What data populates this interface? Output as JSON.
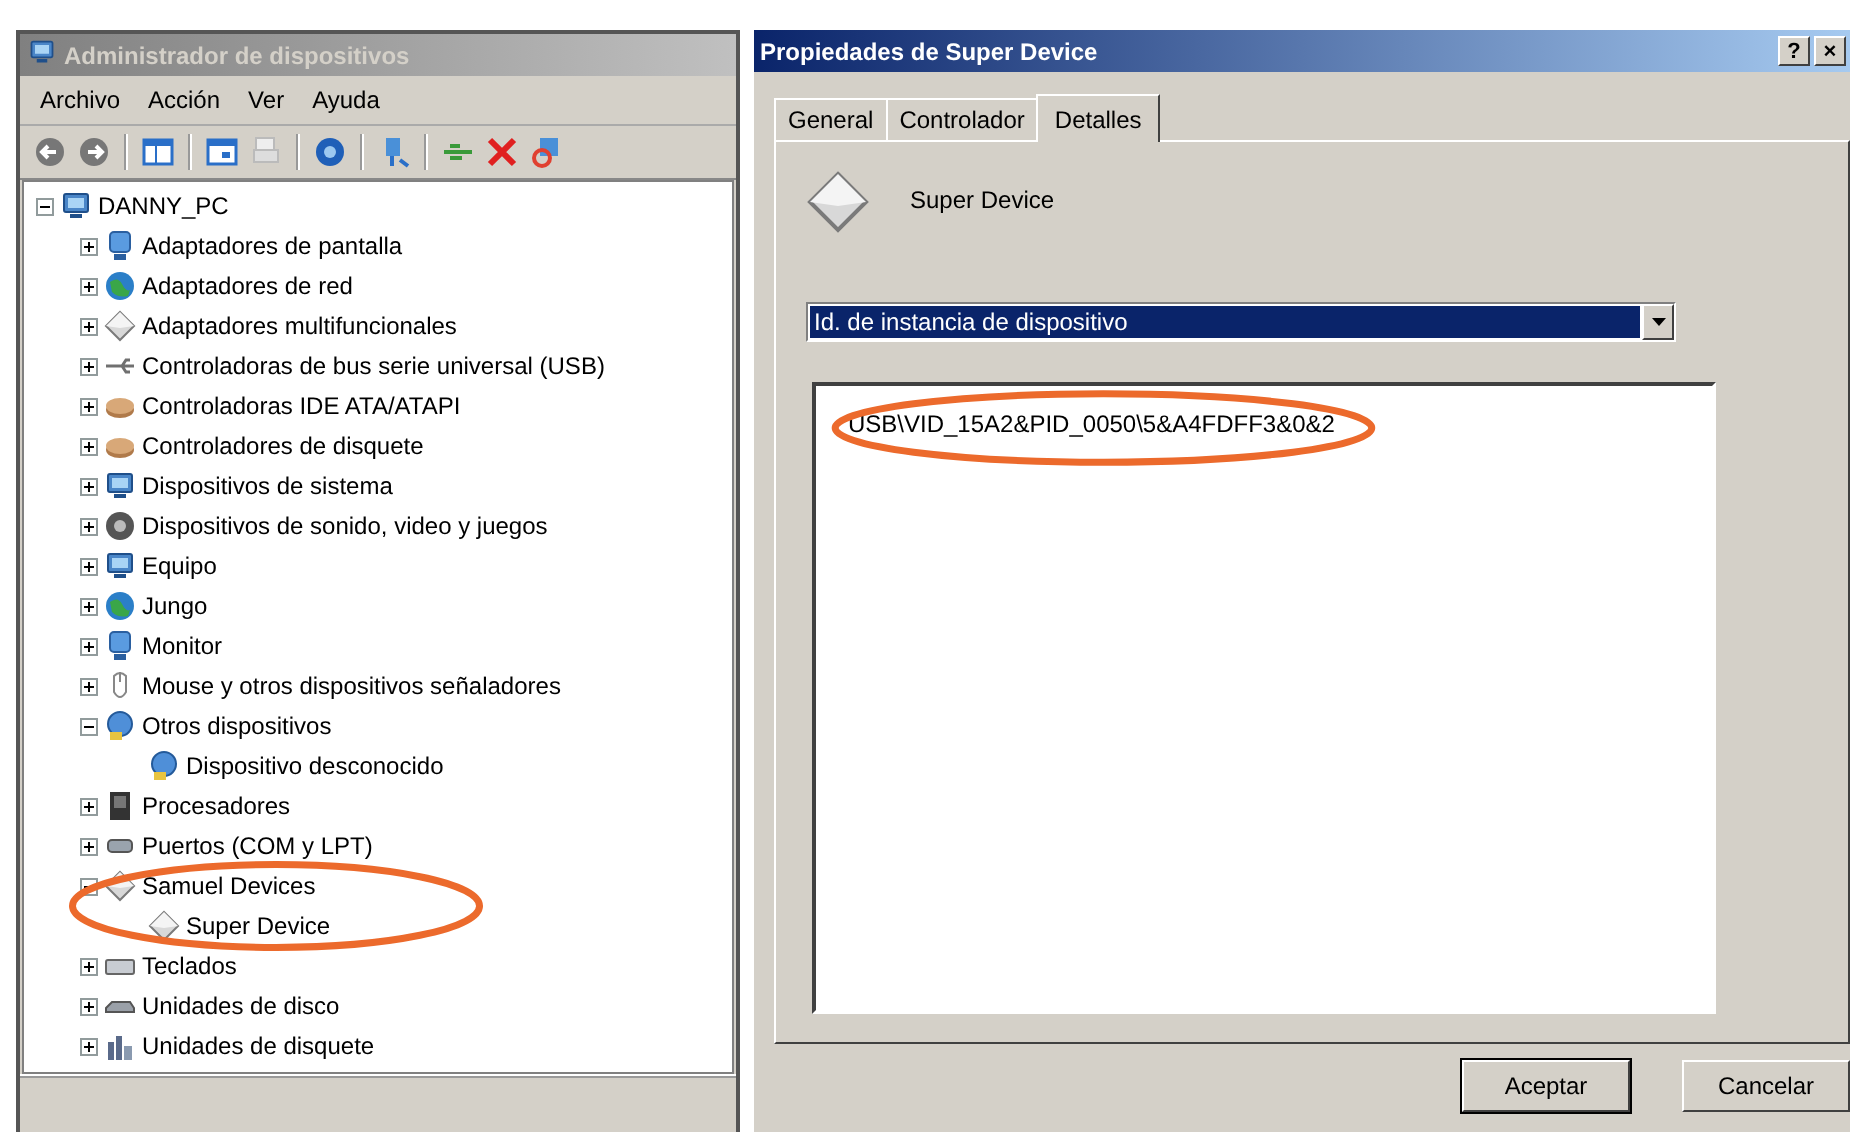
{
  "device_manager": {
    "title": "Administrador de dispositivos",
    "active": false,
    "menu": [
      "Archivo",
      "Acción",
      "Ver",
      "Ayuda"
    ],
    "tree": {
      "label": "DANNY_PC",
      "expanded": true,
      "children": [
        {
          "label": "Adaptadores de pantalla",
          "expanded": false
        },
        {
          "label": "Adaptadores de red",
          "expanded": false
        },
        {
          "label": "Adaptadores multifuncionales",
          "expanded": false
        },
        {
          "label": "Controladoras de bus serie universal (USB)",
          "expanded": false
        },
        {
          "label": "Controladoras IDE ATA/ATAPI",
          "expanded": false
        },
        {
          "label": "Controladores de disquete",
          "expanded": false
        },
        {
          "label": "Dispositivos de sistema",
          "expanded": false
        },
        {
          "label": "Dispositivos de sonido, video y juegos",
          "expanded": false
        },
        {
          "label": "Equipo",
          "expanded": false
        },
        {
          "label": "Jungo",
          "expanded": false
        },
        {
          "label": "Monitor",
          "expanded": false
        },
        {
          "label": "Mouse y otros dispositivos señaladores",
          "expanded": false
        },
        {
          "label": "Otros dispositivos",
          "expanded": true,
          "children": [
            {
              "label": "Dispositivo desconocido"
            }
          ]
        },
        {
          "label": "Procesadores",
          "expanded": false
        },
        {
          "label": "Puertos (COM y LPT)",
          "expanded": false
        },
        {
          "label": "Samuel Devices",
          "expanded": true,
          "circled": true,
          "children": [
            {
              "label": "Super Device"
            }
          ]
        },
        {
          "label": "Teclados",
          "expanded": false
        },
        {
          "label": "Unidades de disco",
          "expanded": false
        },
        {
          "label": "Unidades de disquete",
          "expanded": false
        }
      ]
    }
  },
  "properties_dialog": {
    "title": "Propiedades de Super Device",
    "active": true,
    "title_buttons": [
      "?",
      "×"
    ],
    "tabs": [
      {
        "label": "General",
        "selected": false
      },
      {
        "label": "Controlador",
        "selected": false
      },
      {
        "label": "Detalles",
        "selected": true
      }
    ],
    "device_name": "Super Device",
    "property_dropdown": {
      "value": "Id. de instancia de dispositivo"
    },
    "values": [
      {
        "text": "USB\\VID_15A2&PID_0050\\5&A4FDFF3&0&2",
        "circled": true
      }
    ],
    "buttons": [
      "Aceptar",
      "Cancelar"
    ]
  }
}
